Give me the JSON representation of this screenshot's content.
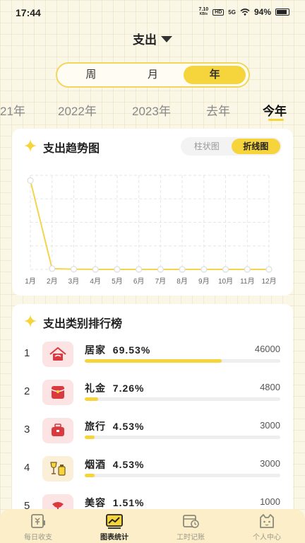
{
  "status_bar": {
    "time": "17:44",
    "net_speed_value": "7.10",
    "net_speed_unit": "KB/s",
    "hd": "HD",
    "signal": "5G",
    "battery": "94%"
  },
  "header": {
    "title": "支出"
  },
  "period_tabs": [
    {
      "label": "周"
    },
    {
      "label": "月"
    },
    {
      "label": "年"
    }
  ],
  "period_selected": "年",
  "year_tabs": [
    {
      "label": "21年"
    },
    {
      "label": "2022年"
    },
    {
      "label": "2023年"
    },
    {
      "label": "去年"
    },
    {
      "label": "今年"
    }
  ],
  "year_selected": "今年",
  "trend": {
    "title": "支出趋势图",
    "toggle": [
      {
        "label": "柱状图"
      },
      {
        "label": "折线图"
      }
    ],
    "toggle_selected": "折线图"
  },
  "chart_data": {
    "type": "line",
    "categories": [
      "1月",
      "2月",
      "3月",
      "4月",
      "5月",
      "6月",
      "7月",
      "8月",
      "9月",
      "10月",
      "11月",
      "12月"
    ],
    "values": [
      66100,
      600,
      150,
      0,
      0,
      0,
      0,
      0,
      0,
      0,
      0,
      0
    ],
    "ylim": [
      0,
      70000
    ],
    "grid": true,
    "line_color": "#f3d54e"
  },
  "ranking": {
    "title": "支出类别排行榜",
    "items": [
      {
        "rank": "1",
        "name": "居家",
        "percent": "69.53%",
        "amount": "46000",
        "fill": 0.7,
        "icon": "house-icon"
      },
      {
        "rank": "2",
        "name": "礼金",
        "percent": "7.26%",
        "amount": "4800",
        "fill": 0.07,
        "icon": "red-envelope-icon"
      },
      {
        "rank": "3",
        "name": "旅行",
        "percent": "4.53%",
        "amount": "3000",
        "fill": 0.05,
        "icon": "suitcase-icon"
      },
      {
        "rank": "4",
        "name": "烟酒",
        "percent": "4.53%",
        "amount": "3000",
        "fill": 0.05,
        "icon": "wine-icon"
      },
      {
        "rank": "5",
        "name": "美容",
        "percent": "1.51%",
        "amount": "1000",
        "fill": 0.02,
        "icon": "beauty-icon"
      }
    ]
  },
  "bottom_nav": [
    {
      "label": "每日收支",
      "icon": "daily-ledger-icon"
    },
    {
      "label": "图表统计",
      "icon": "chart-stats-icon"
    },
    {
      "label": "工时记账",
      "icon": "work-hours-icon"
    },
    {
      "label": "个人中心",
      "icon": "cat-profile-icon"
    }
  ],
  "nav_selected": "图表统计",
  "colors": {
    "accent": "#f6d43b",
    "background": "#fbf7e6",
    "icon_red": "#d9393f"
  }
}
